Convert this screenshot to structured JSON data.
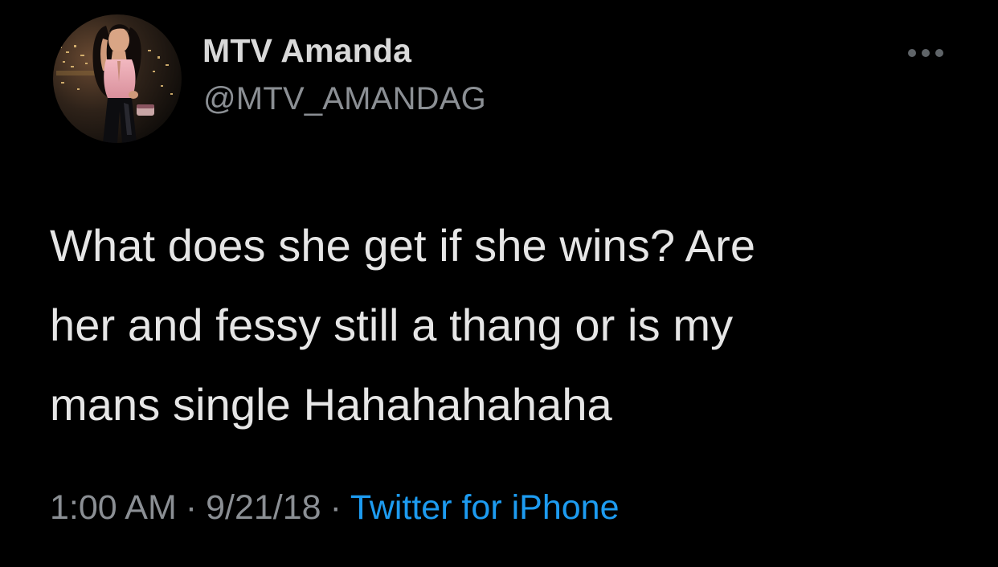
{
  "tweet": {
    "author": {
      "display_name": "MTV Amanda",
      "handle": "@MTV_AMANDAG"
    },
    "text_lines": [
      "What does she get if she wins? Are",
      "her and fessy still a thang or is my",
      "mans single Hahahahahaha"
    ],
    "time": "1:00 AM",
    "date": "9/21/18",
    "separator": "·",
    "source": "Twitter for iPhone"
  },
  "icons": {
    "more": "more-options-icon"
  },
  "colors": {
    "background": "#000000",
    "text": "#e6e6e6",
    "secondary_text": "#8b8f94",
    "link": "#1d9bf0"
  }
}
